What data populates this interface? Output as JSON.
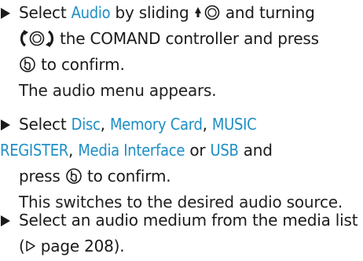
{
  "colors": {
    "text": "#1a1a1a",
    "display_term": "#1d8fc6"
  },
  "icons": {
    "bullet": "right-triangle-bullet-icon",
    "slide_up": "slide-up-controller-icon",
    "turn": "turn-controller-icon",
    "press": "press-controller-icon",
    "page_ref": "page-reference-triangle-icon"
  },
  "steps": [
    {
      "line1": {
        "t1": "Select ",
        "term": "Audio",
        "t2": " by sliding "
      },
      "line1b": {
        "t": " and turning"
      },
      "line2": {
        "t": " the COMAND controller and press"
      },
      "line3": {
        "t": " to confirm."
      },
      "result": "The audio menu appears."
    },
    {
      "line1": {
        "t1": "Select ",
        "term1": "Disc",
        "sep1": ", ",
        "term2": "Memory Card",
        "sep2": ", ",
        "term3": "MUSIC"
      },
      "line2": {
        "term3b": "REGISTER",
        "sep3": ", ",
        "term4": "Media Interface",
        "t1": " or ",
        "term5": "USB",
        "t2": " and"
      },
      "line3": {
        "t1": "press ",
        "t2": " to confirm."
      },
      "result": "This switches to the desired audio source."
    },
    {
      "line1": {
        "t": "Select an audio medium from the media list"
      },
      "line2": {
        "t1": "(",
        "t2": " page 208)."
      }
    }
  ]
}
